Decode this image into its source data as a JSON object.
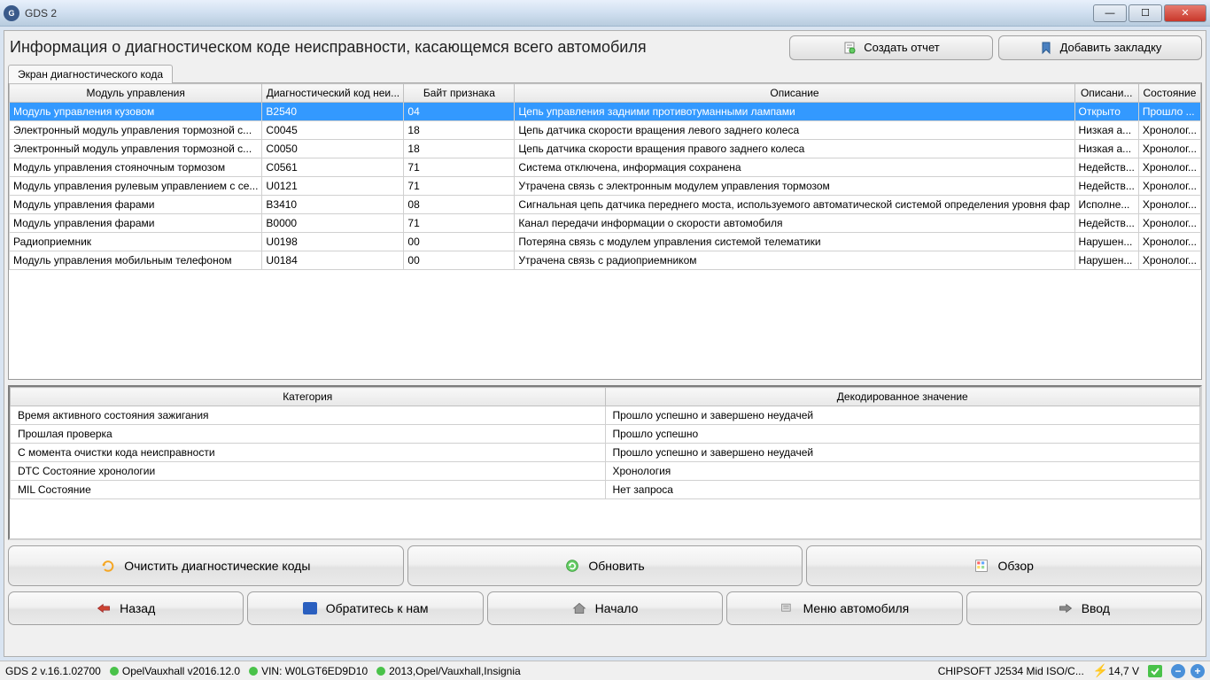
{
  "window": {
    "title": "GDS 2"
  },
  "header": {
    "title": "Информация о диагностическом коде неисправности, касающемся всего автомобиля",
    "create_report": "Создать отчет",
    "add_bookmark": "Добавить закладку"
  },
  "tab": {
    "label": "Экран диагностического кода"
  },
  "table": {
    "headers": {
      "module": "Модуль управления",
      "dtc": "Диагностический код неи...",
      "byte": "Байт признака",
      "desc": "Описание",
      "info": "Описани...",
      "state": "Состояние"
    },
    "rows": [
      {
        "module": "Модуль управления кузовом",
        "dtc": "B2540",
        "byte": "04",
        "desc": "Цепь управления задними противотуманными лампами",
        "info": "Открыто",
        "state": "Прошло ..."
      },
      {
        "module": "Электронный модуль управления тормозной с...",
        "dtc": "C0045",
        "byte": "18",
        "desc": "Цепь датчика скорости вращения левого заднего колеса",
        "info": "Низкая а...",
        "state": "Хронолог..."
      },
      {
        "module": "Электронный модуль управления тормозной с...",
        "dtc": "C0050",
        "byte": "18",
        "desc": "Цепь датчика скорости вращения правого заднего колеса",
        "info": "Низкая а...",
        "state": "Хронолог..."
      },
      {
        "module": "Модуль управления стояночным тормозом",
        "dtc": "C0561",
        "byte": "71",
        "desc": "Система отключена, информация сохранена",
        "info": "Недейств...",
        "state": "Хронолог..."
      },
      {
        "module": "Модуль управления рулевым управлением с се...",
        "dtc": "U0121",
        "byte": "71",
        "desc": "Утрачена связь с электронным модулем управления тормозом",
        "info": "Недейств...",
        "state": "Хронолог..."
      },
      {
        "module": "Модуль управления фарами",
        "dtc": "B3410",
        "byte": "08",
        "desc": "Сигнальная цепь датчика переднего моста, используемого автоматической системой определения уровня фар",
        "info": "Исполне...",
        "state": "Хронолог..."
      },
      {
        "module": "Модуль управления фарами",
        "dtc": "B0000",
        "byte": "71",
        "desc": "Канал передачи информации о скорости автомобиля",
        "info": "Недейств...",
        "state": "Хронолог..."
      },
      {
        "module": "Радиоприемник",
        "dtc": "U0198",
        "byte": "00",
        "desc": "Потеряна связь с модулем управления системой телематики",
        "info": "Нарушен...",
        "state": "Хронолог..."
      },
      {
        "module": "Модуль управления мобильным телефоном",
        "dtc": "U0184",
        "byte": "00",
        "desc": "Утрачена связь с радиоприемником",
        "info": "Нарушен...",
        "state": "Хронолог..."
      }
    ]
  },
  "details": {
    "headers": {
      "category": "Категория",
      "decoded": "Декодированное значение"
    },
    "rows": [
      {
        "cat": "Время активного состояния зажигания",
        "val": "Прошло успешно и завершено неудачей"
      },
      {
        "cat": "Прошлая проверка",
        "val": "Прошло успешно"
      },
      {
        "cat": "С момента очистки кода неисправности",
        "val": "Прошло успешно и завершено неудачей"
      },
      {
        "cat": "DTC Состояние хронологии",
        "val": "Хронология"
      },
      {
        "cat": "MIL Состояние",
        "val": "Нет запроса"
      }
    ]
  },
  "actions": {
    "clear": "Очистить диагностические коды",
    "refresh": "Обновить",
    "overview": "Обзор"
  },
  "nav": {
    "back": "Назад",
    "contact": "Обратитесь к нам",
    "home": "Начало",
    "vehicle_menu": "Меню автомобиля",
    "enter": "Ввод"
  },
  "status": {
    "version": "GDS 2 v.16.1.02700",
    "software": "OpelVauxhall v2016.12.0",
    "vin": "VIN: W0LGT6ED9D10",
    "vehicle": "2013,Opel/Vauxhall,Insignia",
    "interface": "CHIPSOFT J2534 Mid ISO/C...",
    "voltage": "14,7 V"
  }
}
